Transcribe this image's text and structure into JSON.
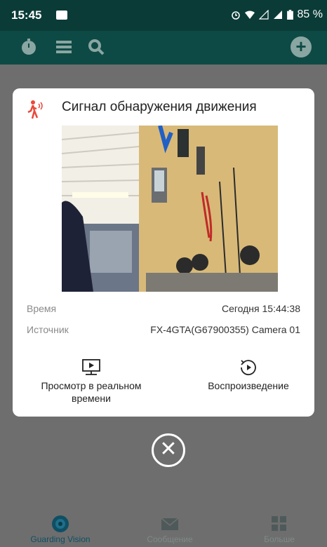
{
  "status_bar": {
    "time": "15:45",
    "battery": "85 %"
  },
  "dialog": {
    "title": "Сигнал обнаружения движения",
    "time_label": "Время",
    "time_value": "Сегодня 15:44:38",
    "source_label": "Источник",
    "source_value": "FX-4GTA(G67900355) Camera 01",
    "live_view_label": "Просмотр в реальном времени",
    "playback_label": "Воспроизведение"
  },
  "bottom_nav": {
    "items": [
      {
        "label": "Guarding Vision",
        "icon": "guarding-vision-icon",
        "active": true
      },
      {
        "label": "Сообщение",
        "icon": "message-icon",
        "active": false
      },
      {
        "label": "Больше",
        "icon": "more-icon",
        "active": false
      }
    ]
  },
  "colors": {
    "header": "#0e4a45",
    "overlay": "#6e6e6e",
    "motion_alert": "#e8493c"
  }
}
